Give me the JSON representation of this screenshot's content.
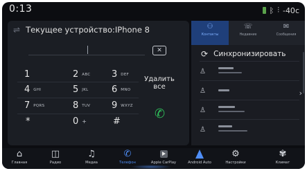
{
  "status": {
    "time": "0:13",
    "temperature": "-40",
    "temperature_unit": "c"
  },
  "dialer": {
    "device_label": "Текущее устройство:IPhone 8",
    "number_value": "",
    "delete_all_label": "Удалить все",
    "keys": [
      {
        "digit": "1",
        "letters": ""
      },
      {
        "digit": "2",
        "letters": "ABC"
      },
      {
        "digit": "3",
        "letters": "DEF"
      },
      {
        "digit": "4",
        "letters": "GHI"
      },
      {
        "digit": "5",
        "letters": "JKL"
      },
      {
        "digit": "6",
        "letters": "MNO"
      },
      {
        "digit": "7",
        "letters": "PQRS"
      },
      {
        "digit": "8",
        "letters": "TUV"
      },
      {
        "digit": "9",
        "letters": "WXYZ"
      },
      {
        "digit": "*",
        "letters": ""
      },
      {
        "digit": "0",
        "letters": "+"
      },
      {
        "digit": "#",
        "letters": ""
      }
    ]
  },
  "contacts_panel": {
    "tabs": [
      {
        "label": "Контакты",
        "icon": "contacts-icon",
        "active": true
      },
      {
        "label": "Недавние",
        "icon": "recent-calls-icon",
        "active": false
      },
      {
        "label": "Сообщения",
        "icon": "messages-icon",
        "active": false
      }
    ],
    "sync_label": "Синхронизировать"
  },
  "dock": {
    "items": [
      {
        "label": "Главная",
        "icon": "home-icon",
        "active": false
      },
      {
        "label": "Радио",
        "icon": "radio-icon",
        "active": false
      },
      {
        "label": "Медиа",
        "icon": "music-icon",
        "active": false
      },
      {
        "label": "Телефон",
        "icon": "phone-icon",
        "active": true
      },
      {
        "label": "Apple CarPlay",
        "icon": "carplay-icon",
        "active": false
      },
      {
        "label": "Android Auto",
        "icon": "android-auto-icon",
        "active": false
      },
      {
        "label": "Настройки",
        "icon": "settings-icon",
        "active": false
      },
      {
        "label": "Климат",
        "icon": "fan-icon",
        "active": false
      }
    ]
  },
  "colors": {
    "accent": "#4f8ef7",
    "call_green": "#2fbf5a",
    "panel": "#1b1e24",
    "background": "#0c0d11"
  }
}
